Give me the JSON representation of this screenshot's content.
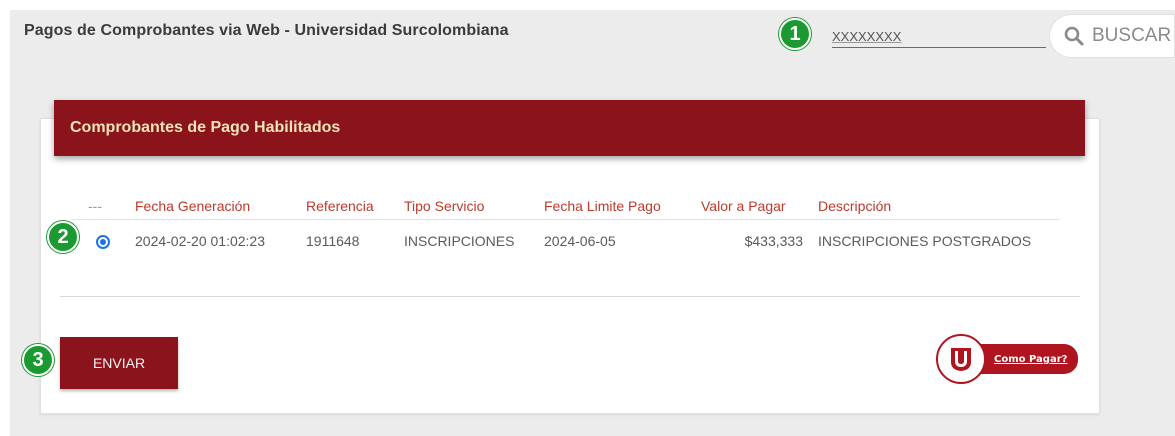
{
  "app": {
    "title": "Pagos de Comprobantes via Web - Universidad Surcolombiana"
  },
  "search": {
    "value": "XXXXXXXX",
    "button_label": "BUSCAR",
    "icon": "search-icon"
  },
  "steps": [
    "1",
    "2",
    "3"
  ],
  "card": {
    "title": "Comprobantes de Pago Habilitados"
  },
  "table": {
    "columns": [
      "---",
      "Fecha Generación",
      "Referencia",
      "Tipo Servicio",
      "Fecha Limite Pago",
      "Valor a Pagar",
      "Descripción"
    ],
    "rows": [
      {
        "selected": true,
        "fecha_generacion": "2024-02-20 01:02:23",
        "referencia": "1911648",
        "tipo_servicio": "INSCRIPCIONES",
        "fecha_limite": "2024-06-05",
        "valor": "$433,333",
        "descripcion": "INSCRIPCIONES POSTGRADOS"
      }
    ]
  },
  "actions": {
    "send_label": "ENVIAR",
    "how_to_pay_label": "Como Pagar?"
  },
  "colors": {
    "brand": "#8b141c",
    "header_text": "#f3e3b8",
    "step_badge": "#1a9a30",
    "column_header": "#c0392b",
    "radio": "#1a73e8"
  }
}
